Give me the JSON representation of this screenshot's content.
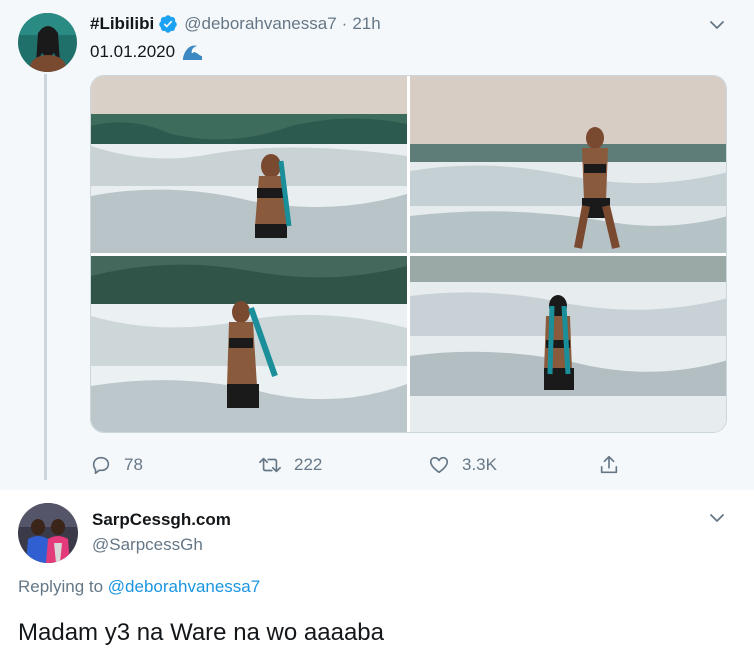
{
  "parent_tweet": {
    "display_name": "#Libilibi",
    "handle": "@deborahvanessa7",
    "separator": "·",
    "time": "21h",
    "text": "01.01.2020",
    "emoji": "water-wave-icon",
    "photos": [
      {
        "name": "photo-beach-1"
      },
      {
        "name": "photo-beach-2"
      },
      {
        "name": "photo-beach-3"
      },
      {
        "name": "photo-beach-4"
      }
    ],
    "actions": {
      "reply_count": "78",
      "retweet_count": "222",
      "like_count": "3.3K"
    }
  },
  "reply_tweet": {
    "display_name": "SarpCessgh.com",
    "handle": "@SarpcessGh",
    "replying_prefix": "Replying to",
    "replying_to": "@deborahvanessa7",
    "text": "Madam y3 na Ware na wo aaaaba"
  },
  "colors": {
    "link": "#1b95e0",
    "secondary_text": "#657786",
    "verified": "#1da1f2",
    "parent_bg": "#f5f8fa"
  }
}
